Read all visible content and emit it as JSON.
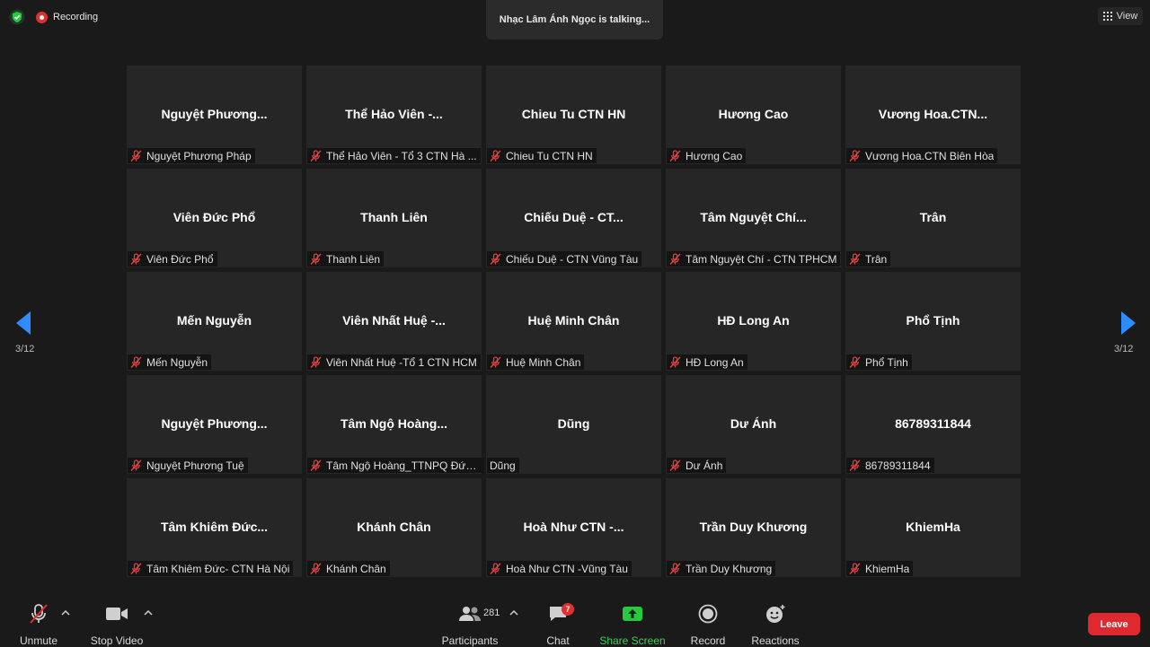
{
  "recording": {
    "label": "Recording"
  },
  "talking": {
    "text": "Nhạc Lâm Ánh Ngọc is talking..."
  },
  "view": {
    "label": "View"
  },
  "pagination": {
    "left": "3/12",
    "right": "3/12"
  },
  "participants": [
    {
      "display": "Nguyệt  Phương...",
      "name": "Nguyệt Phương Pháp",
      "muted": true
    },
    {
      "display": "Thể Hảo Viên -...",
      "name": "Thể Hảo Viên - Tổ 3 CTN Hà ...",
      "muted": true
    },
    {
      "display": "Chieu Tu CTN HN",
      "name": "Chieu Tu CTN HN",
      "muted": true
    },
    {
      "display": "Hương Cao",
      "name": "Hương Cao",
      "muted": true
    },
    {
      "display": "Vương  Hoa.CTN...",
      "name": "Vương Hoa.CTN Biên Hòa",
      "muted": true
    },
    {
      "display": "Viên Đức Phổ",
      "name": "Viên Đức Phổ",
      "muted": true
    },
    {
      "display": "Thanh Liên",
      "name": "Thanh Liên",
      "muted": true
    },
    {
      "display": "Chiếu Duệ - CT...",
      "name": "Chiếu Duệ - CTN Vũng Tàu",
      "muted": true
    },
    {
      "display": "Tâm Nguyệt Chí...",
      "name": "Tâm Nguyệt Chí - CTN TPHCM",
      "muted": true
    },
    {
      "display": "Trân",
      "name": "Trân",
      "muted": true
    },
    {
      "display": "Mến Nguyễn",
      "name": "Mến Nguyễn",
      "muted": true
    },
    {
      "display": "Viên Nhất Huệ -...",
      "name": "Viên Nhất Huệ -Tổ 1 CTN HCM",
      "muted": true
    },
    {
      "display": "Huệ Minh Chân",
      "name": "Huệ Minh Chân",
      "muted": true
    },
    {
      "display": "HĐ Long An",
      "name": "HĐ Long An",
      "muted": true
    },
    {
      "display": "Phổ Tịnh",
      "name": "Phổ Tịnh",
      "muted": true
    },
    {
      "display": "Nguyệt  Phương...",
      "name": "Nguyệt Phương Tuệ",
      "muted": true
    },
    {
      "display": "Tâm  Ngộ  Hoàng...",
      "name": "Tâm Ngộ Hoàng_TTNPQ Đức ...",
      "muted": true
    },
    {
      "display": "Dũng",
      "name": "Dũng",
      "muted": false
    },
    {
      "display": "Dư  Ánh",
      "name": "Dư  Ánh",
      "muted": true
    },
    {
      "display": "86789311844",
      "name": "86789311844",
      "muted": true
    },
    {
      "display": "Tâm  Khiêm  Đức...",
      "name": "Tâm Khiêm Đức- CTN Hà Nội",
      "muted": true
    },
    {
      "display": "Khánh Chân",
      "name": "Khánh Chân",
      "muted": true
    },
    {
      "display": "Hoà  Như  CTN  -...",
      "name": "Hoà Như CTN -Vũng Tàu",
      "muted": true
    },
    {
      "display": "Trần Duy Khương",
      "name": "Trần Duy Khương",
      "muted": true
    },
    {
      "display": "KhiemHa",
      "name": "KhiemHa",
      "muted": true
    }
  ],
  "toolbar": {
    "unmute": "Unmute",
    "stop_video": "Stop Video",
    "participants": "Participants",
    "participants_count": "281",
    "chat": "Chat",
    "chat_badge": "7",
    "share_screen": "Share Screen",
    "record": "Record",
    "reactions": "Reactions",
    "leave": "Leave"
  },
  "colors": {
    "accent_green": "#27c93f",
    "danger_red": "#e0292e",
    "nav_blue": "#2d8cff",
    "share_text": "#3ccf5a"
  }
}
